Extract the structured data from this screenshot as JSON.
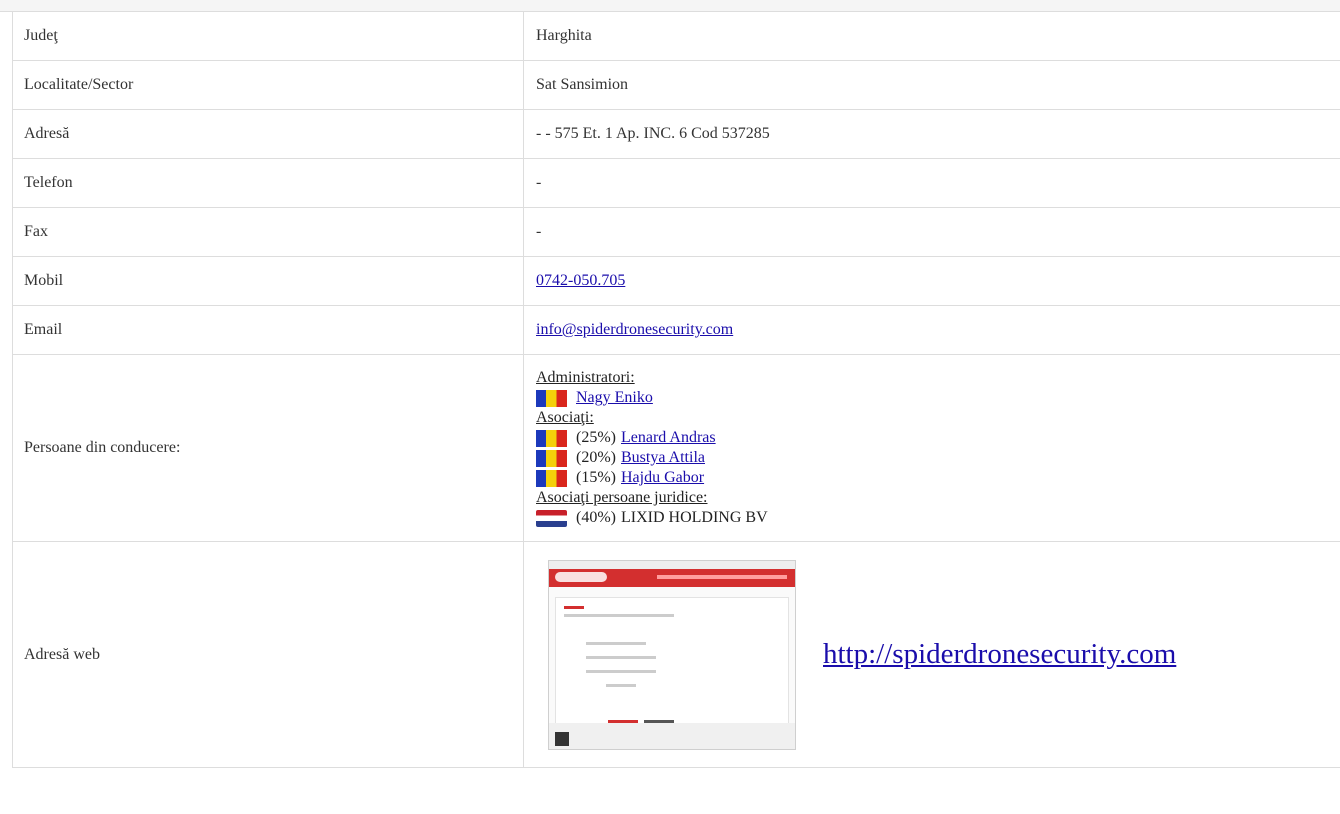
{
  "rows": [
    {
      "label": "Judeţ",
      "value": "Harghita"
    },
    {
      "label": "Localitate/Sector",
      "value": "Sat Sansimion"
    },
    {
      "label": "Adresă",
      "value": "- - 575 Et. 1 Ap. INC. 6 Cod 537285"
    },
    {
      "label": "Telefon",
      "value": "-"
    },
    {
      "label": "Fax",
      "value": "-"
    },
    {
      "label": "Mobil",
      "value": "0742-050.705"
    },
    {
      "label": "Email",
      "value": "info@spiderdronesecurity.com"
    }
  ],
  "persons": {
    "label": "Persoane din conducere:",
    "administrators_heading": "Administratori:",
    "administrators": [
      {
        "name": "Nagy Eniko",
        "flag": "romania-flag-icon"
      }
    ],
    "associates_heading": "Asociaţi:",
    "associates": [
      {
        "percent": "(25%)",
        "name": "Lenard Andras",
        "flag": "romania-flag-icon"
      },
      {
        "percent": "(20%)",
        "name": "Bustya Attila",
        "flag": "romania-flag-icon"
      },
      {
        "percent": "(15%)",
        "name": "Hajdu Gabor",
        "flag": "romania-flag-icon"
      }
    ],
    "legal_heading": "Asociaţi persoane juridice:",
    "legal": [
      {
        "percent": "(40%)",
        "name": "LIXID HOLDING BV",
        "flag": "netherlands-flag-icon"
      }
    ]
  },
  "web": {
    "label": "Adresă web",
    "url": "http://spiderdronesecurity.com"
  },
  "colors": {
    "link": "#1a0dab",
    "border": "#dddddd",
    "thumbnail_brand": "#d32f2f"
  }
}
